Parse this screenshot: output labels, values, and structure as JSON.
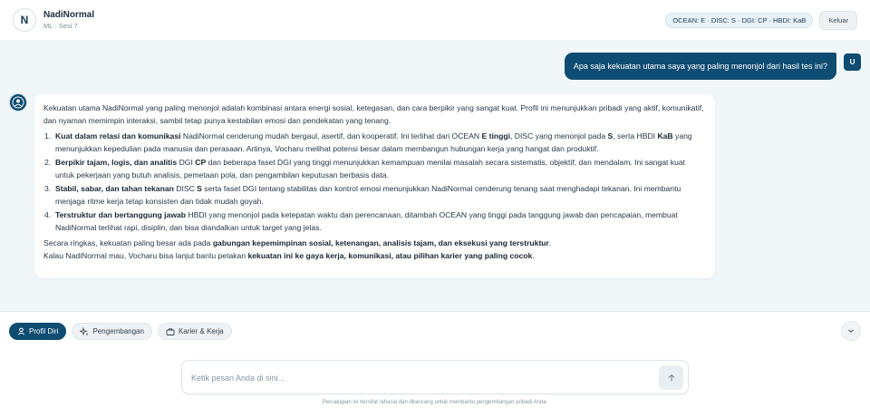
{
  "header": {
    "avatar_letter": "N",
    "name": "NadiNormal",
    "subtitle": "ML · Sesi 7",
    "profile_badge": "OCEAN: E · DISC: S · DGI: CP · HBDI: KaB",
    "logout_label": "Keluar"
  },
  "user_message": {
    "text": "Apa saja kekuatan utama saya yang paling menonjol dari hasil tes ini?",
    "avatar": "U"
  },
  "bot_message": {
    "intro": "Kekuatan utama NadiNormal yang paling menonjol adalah kombinasi antara energi sosial, ketegasan, dan cara berpikir yang sangat kuat. Profil ini menunjukkan pribadi yang aktif, komunikatif, dan nyaman memimpin interaksi, sambil tetap punya kestabilan emosi dan pendekatan yang tenang.",
    "points": [
      {
        "num": "1.",
        "b1": "Kuat dalam relasi dan komunikasi",
        "t1": " NadiNormal cenderung mudah bergaul, asertif, dan kooperatif. Ini terlihat dari OCEAN ",
        "b2": "E tinggi",
        "t2": ", DISC yang menonjol pada ",
        "b3": "S",
        "t3": ", serta HBDI ",
        "b4": "KaB",
        "t4": " yang menunjukkan kepedulian pada manusia dan perasaan. Artinya, Vocharu melihat potensi besar dalam membangun hubungan kerja yang hangat dan produktif."
      },
      {
        "num": "2.",
        "b1": "Berpikir tajam, logis, dan analitis",
        "t1": " DGI ",
        "b2": "CP",
        "t2": " dan beberapa faset DGI yang tinggi menunjukkan kemampuan menilai masalah secara sistematis, objektif, dan mendalam. Ini sangat kuat untuk pekerjaan yang butuh analisis, pemetaan pola, dan pengambilan keputusan berbasis data."
      },
      {
        "num": "3.",
        "b1": "Stabil, sabar, dan tahan tekanan",
        "t1": " DISC ",
        "b2": "S",
        "t2": " serta faset DGI tentang stabilitas dan kontrol emosi menunjukkan NadiNormal cenderung tenang saat menghadapi tekanan. Ini membantu menjaga ritme kerja tetap konsisten dan tidak mudah goyah."
      },
      {
        "num": "4.",
        "b1": "Terstruktur dan bertanggung jawab",
        "t1": " HBDI yang menonjol pada ketepatan waktu dan perencanaan, ditambah OCEAN yang tinggi pada tanggung jawab dan pencapaian, membuat NadiNormal terlihat rapi, disiplin, dan bisa diandalkan untuk target yang jelas."
      }
    ],
    "summary_pre": "Secara ringkas, kekuatan paling besar ada pada ",
    "summary_bold": "gabungan kepemimpinan sosial, ketenangan, analisis tajam, dan eksekusi yang terstruktur",
    "summary_post": ".",
    "closing_pre": "Kalau NadiNormal mau, Vocharu bisa lanjut bantu petakan ",
    "closing_bold": "kekuatan ini ke gaya kerja, komunikasi, atau pilihan karier yang paling cocok",
    "closing_post": "."
  },
  "tabs": [
    {
      "label": "Profil Diri",
      "icon": "user-icon",
      "active": true
    },
    {
      "label": "Pengembangan",
      "icon": "sparkle-icon",
      "active": false
    },
    {
      "label": "Karier & Kerja",
      "icon": "briefcase-icon",
      "active": false
    }
  ],
  "input": {
    "placeholder": "Ketik pesan Anda di sini..."
  },
  "footer_note": "Percakapan ini bersifat rahasia dan dirancang untuk membantu pengembangan pribadi Anda.",
  "colors": {
    "accent": "#0f4c72",
    "background": "#f1f6f9"
  }
}
